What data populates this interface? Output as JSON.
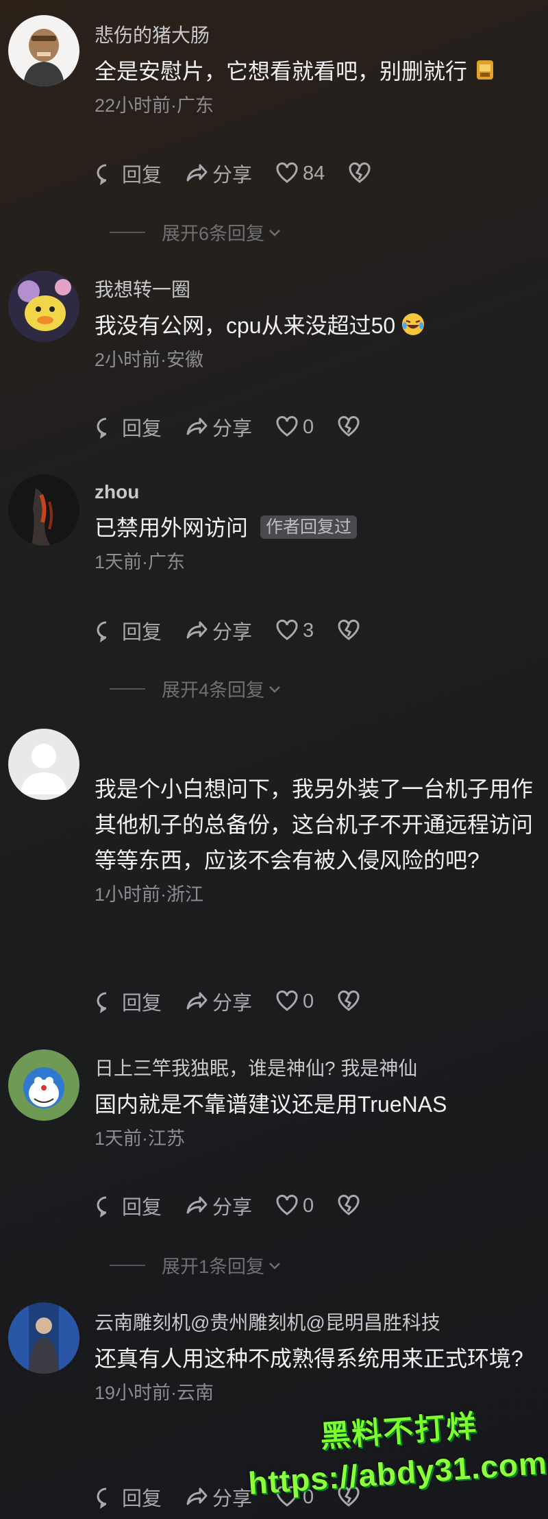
{
  "colors": {
    "background": "#1e1e20",
    "text": "#f1f1f2",
    "muted": "#8c8c91",
    "watermark": "#7dff2e"
  },
  "comments": [
    {
      "username": "悲伤的猪大肠",
      "text": "全是安慰片，它想看就看吧，别删就行",
      "meta": "22小时前·广东",
      "reply": "回复",
      "share": "分享",
      "likes": "84",
      "expand": "展开6条回复"
    },
    {
      "username": "我想转一圈",
      "text": "我没有公网，cpu从来没超过50",
      "meta": "2小时前·安徽",
      "reply": "回复",
      "share": "分享",
      "likes": "0"
    },
    {
      "username": "zhou",
      "text": "已禁用外网访问",
      "tag": "作者回复过",
      "meta": "1天前·广东",
      "reply": "回复",
      "share": "分享",
      "likes": "3",
      "expand": "展开4条回复"
    },
    {
      "username": "",
      "text": "我是个小白想问下，我另外装了一台机子用作其他机子的总备份，这台机子不开通远程访问等等东西，应该不会有被入侵风险的吧?",
      "meta": "1小时前·浙江",
      "reply": "回复",
      "share": "分享",
      "likes": "0"
    },
    {
      "username": "日上三竿我独眠，谁是神仙? 我是神仙",
      "text": "国内就是不靠谱建议还是用TrueNAS",
      "meta": "1天前·江苏",
      "reply": "回复",
      "share": "分享",
      "likes": "0",
      "expand": "展开1条回复"
    },
    {
      "username": "云南雕刻机@贵州雕刻机@昆明昌胜科技",
      "text": "还真有人用这种不成熟得系统用来正式环境?",
      "meta": "19小时前·云南",
      "reply": "回复",
      "share": "分享",
      "likes": "0"
    }
  ],
  "watermark": {
    "line1": "黑料不打烊",
    "line2": "https://abdy31.com"
  }
}
